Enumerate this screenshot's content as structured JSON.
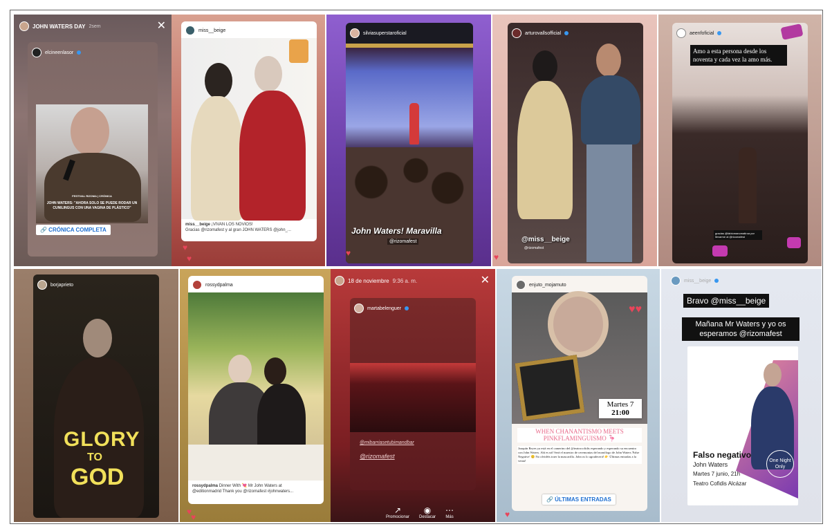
{
  "p1": {
    "user": "JOHN WATERS DAY",
    "time": "2sem",
    "repost_user": "elcineenlasor",
    "kicker": "FESTIVAL RIZOMA | CRÓNICA",
    "headline": "JOHN WATERS: \"AHORA SOLO SE PUEDE RODAR UN CUNILINGUS CON UNA VAGINA DE PLÁSTICO\"",
    "link": "🔗 CRÓNICA COMPLETA"
  },
  "p2": {
    "user": "miss__beige",
    "caption_user": "miss__beige",
    "caption": "¡VIVAN LOS NOVIOS!",
    "caption2": "Gracias @rizomafest y al gran JOHN WATERS @john_..."
  },
  "p3": {
    "user": "silviasuperstaroficial",
    "title": "John Waters! Maravilla",
    "tag": "@rizomafest"
  },
  "p4": {
    "user": "arturovallsofficial",
    "mention": "@miss__beige",
    "tag": "@rizomafest"
  },
  "p5": {
    "user": "aeenfoficial",
    "quote": "Amo a esta persona desde los noventa y cada vez la amo más.",
    "thanks": "gracias @fabiomanomatiroa por llevarme al @rizomafest"
  },
  "p6": {
    "user": "borjaprieto",
    "line1": "GLORY",
    "line2": "TO",
    "line3": "GOD"
  },
  "p7": {
    "user": "rossydpalma",
    "caption_user": "rossydpalma",
    "caption": "Dinner With 💘 Mr John Waters at",
    "caption2": "@editionmadrid Thank you @rizomafest #johnwaters..."
  },
  "p8": {
    "date": "18 de noviembre",
    "time": "9:36 a. m.",
    "repost_user": "martabelenguer",
    "tag1": "@mibarriasetubimandbar",
    "tag2": "@rizomafest",
    "act1": "Promocionar",
    "act2": "Destacar",
    "act3": "Más"
  },
  "p9": {
    "user": "enjuto_mojamuto",
    "date1": "Martes 7",
    "date2": "21:00",
    "headline": "WHEN CHANANTISMO MEETS PINKFLAMINGUISMO 🦩",
    "body": "Joaquín Reyes ya está en el camerino del @teatrocofidis esperando y esperando su encuentro con John Waters. Ahí es ná! Será el maestro de ceremonias del monólogo de John Waters 'False Negative' 😊 No olvidéis traer la mascarilla. John os lo agradecerá! 👉 Últimas entradas a la venta!",
    "link": "🔗 ÚLTIMAS ENTRADAS"
  },
  "p10": {
    "user": "miss__beige",
    "line1": "Bravo @miss__beige",
    "line2": "Mañana Mr Waters y yo os esperamos @rizomafest",
    "poster_title": "Falso negativo",
    "poster_name": "John Waters",
    "poster_date": "Martes 7 junio, 21h",
    "poster_venue": "Teatro Cofidis Alcázar",
    "poster_badge": "One Night Only"
  },
  "colors": {
    "heart": "#e8455a",
    "verified": "#3897f0",
    "link": "#1f6fd1"
  }
}
